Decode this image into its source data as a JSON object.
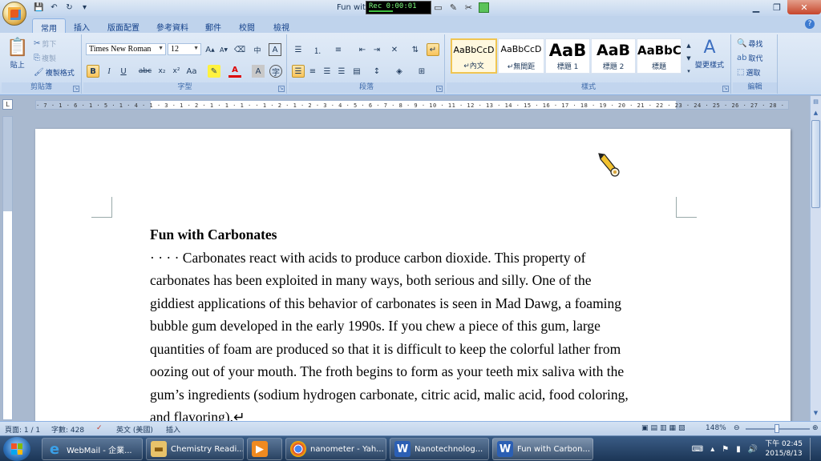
{
  "window": {
    "title": "Fun with",
    "recorder_time": "Rec 0:00:01"
  },
  "tabs": [
    "常用",
    "插入",
    "版面配置",
    "參考資料",
    "郵件",
    "校閱",
    "檢視"
  ],
  "ribbon": {
    "clipboard": {
      "paste": "貼上",
      "cut": "剪下",
      "copy": "複製",
      "format_painter": "複製格式",
      "group_label": "剪貼簿"
    },
    "font": {
      "font_name": "Times New Roman",
      "font_size": "12",
      "group_label": "字型"
    },
    "paragraph": {
      "group_label": "段落"
    },
    "styles": {
      "items": [
        {
          "preview": "AaBbCcD",
          "name": "↵內文"
        },
        {
          "preview": "AaBbCcD",
          "name": "↵無間距"
        },
        {
          "preview": "AaB",
          "name": "標題 1"
        },
        {
          "preview": "AaB",
          "name": "標題 2"
        },
        {
          "preview": "AaBbC",
          "name": "標題"
        }
      ],
      "change_styles": "變更樣式",
      "group_label": "樣式"
    },
    "editing": {
      "find": "尋找",
      "replace": "取代",
      "select": "選取",
      "group_label": "編輯"
    }
  },
  "ruler_ticks": "· 7 · 1 · 6 · 1 · 5 · 1 · 4 · 1 · 3 · 1 · 2 · 1 · 1 · 1 ·   · 1 · 2 · 1 · 2 · 3 · 4 · 5 · 6 · 7 · 8 · 9 · 10 · 11 · 12 · 13 · 14 · 15 · 16 · 17 · 18 · 19 · 20 · 21 · 22 · 23 · 24 · 25 · 26 · 27 · 28 · 29 · 30 · 31 · 32 · 33 · 34 · 35 · 36 · 37 · 38 · 39 · 40 · 41 · 42",
  "document": {
    "title": "Fun with Carbonates",
    "lines": [
      "· · · · Carbonates react with acids to produce carbon dioxide. This property of",
      "carbonates has been exploited in many ways, both serious and silly. One of the",
      "giddiest applications of this behavior of carbonates is seen in Mad Dawg, a foaming",
      "bubble gum developed in the early 1990s. If you chew a piece of this gum, large",
      "quantities of foam are produced so that it is difficult to keep the colorful lather from",
      "oozing out of your mouth. The froth begins to form as your teeth mix saliva with the",
      "gum’s ingredients (sodium hydrogen carbonate, citric acid, malic acid, food coloring,",
      "and flavoring).↵"
    ]
  },
  "status": {
    "page": "頁面: 1 / 1",
    "words": "字數: 428",
    "language": "英文 (美國)",
    "mode": "插入",
    "zoom": "148%"
  },
  "taskbar": {
    "items": [
      {
        "label": "WebMail - 企業..."
      },
      {
        "label": "Chemistry Readi..."
      },
      {
        "label": ""
      },
      {
        "label": "nanometer - Yah..."
      },
      {
        "label": "Nanotechnolog..."
      },
      {
        "label": "Fun with Carbon..."
      }
    ],
    "time": "下午 02:45",
    "date": "2015/8/13"
  },
  "colors": {
    "ribbon_bg": "#d4e2f3",
    "page": "#ffffff",
    "taskbar": "#1c3656"
  }
}
